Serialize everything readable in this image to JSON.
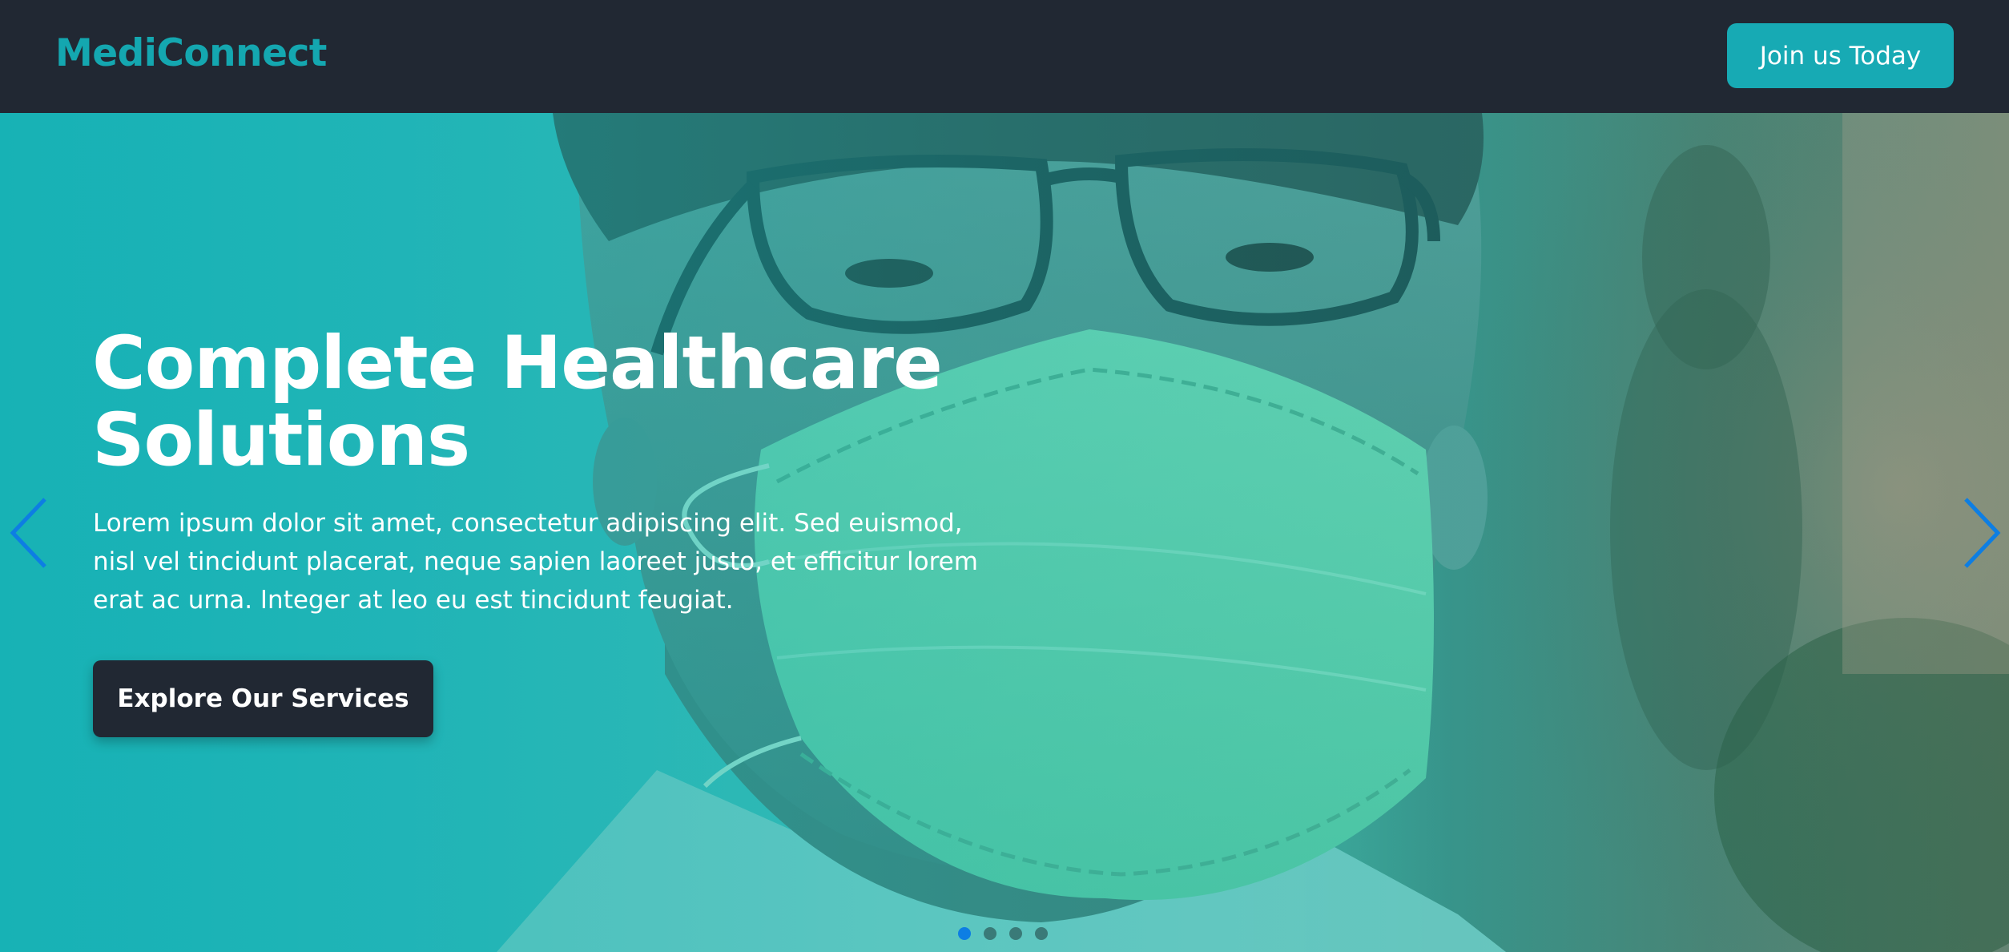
{
  "header": {
    "logo": "MediConnect",
    "join_button": "Join us Today"
  },
  "hero": {
    "title": "Complete Healthcare Solutions",
    "description": "Lorem ipsum dolor sit amet, consectetur adipiscing elit. Sed euismod, nisl vel tincidunt placerat, neque sapien laoreet justo, et efficitur lorem erat ac urna. Integer at leo eu est tincidunt feugiat.",
    "cta_button": "Explore Our Services",
    "image_subject": "man-wearing-surgical-mask-and-glasses"
  },
  "carousel": {
    "prev_icon": "chevron-left-icon",
    "next_icon": "chevron-right-icon",
    "slide_count": 4,
    "active_index": 0
  },
  "colors": {
    "header_bg": "#212833",
    "brand_teal": "#14a7b0",
    "button_teal": "#17aab4",
    "dark_button": "#212833",
    "arrow_blue": "#0d7ee3",
    "active_dot": "#0d7ee3"
  }
}
